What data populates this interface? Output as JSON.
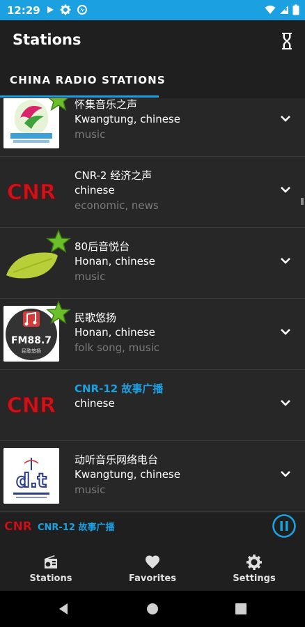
{
  "status_bar": {
    "time": "12:29",
    "background": "#1ba1e2"
  },
  "app_bar": {
    "title": "Stations",
    "action_icon": "hourglass-icon"
  },
  "tabs": [
    {
      "label": "CHINA RADIO STATIONS",
      "selected": true
    }
  ],
  "stations": [
    {
      "name": "怀集音乐之声",
      "location": "Kwangtung, chinese",
      "tags": "music",
      "logo": "huaiji-logo",
      "favorite": true,
      "active": false
    },
    {
      "name": "CNR-2 经济之声",
      "location": "chinese",
      "tags": "economic, news",
      "logo": "cnr-logo",
      "favorite": false,
      "active": false
    },
    {
      "name": "80后音悦台",
      "location": "Honan, chinese",
      "tags": "music",
      "logo": "leaf-logo",
      "favorite": true,
      "active": false
    },
    {
      "name": "民歌悠扬",
      "location": "Honan, chinese",
      "tags": "folk song, music",
      "logo": "fm887-logo",
      "favorite": true,
      "active": false
    },
    {
      "name": "CNR-12 故事广播",
      "location": "chinese",
      "tags": "",
      "logo": "cnr-logo",
      "favorite": false,
      "active": true
    },
    {
      "name": "动听音乐网络电台",
      "location": "Kwangtung, chinese",
      "tags": "music",
      "logo": "dt-logo",
      "favorite": false,
      "active": false
    }
  ],
  "logo_text": {
    "fm": "FM88.7",
    "fm_sub": "民歌悠扬",
    "cnr": "CNR",
    "dt": "d.t"
  },
  "now_playing": {
    "name": "CNR-12 故事广播",
    "logo_text": "CNR",
    "state": "playing",
    "button_icon": "pause-icon"
  },
  "bottom_nav": [
    {
      "label": "Stations",
      "icon": "radio-icon"
    },
    {
      "label": "Favorites",
      "icon": "heart-icon"
    },
    {
      "label": "Settings",
      "icon": "gear-icon"
    }
  ],
  "colors": {
    "accent": "#1ba1e2",
    "cnr_red": "#c8151b",
    "star_green": "#6abf2a"
  }
}
